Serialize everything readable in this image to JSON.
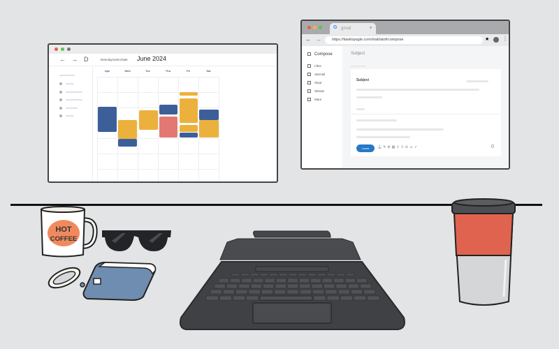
{
  "calendar": {
    "breadcrumb": "Deenlaymartcchate",
    "month": "June 2024",
    "days": [
      "Upe",
      "Wed",
      "Tue",
      "Thu",
      "Fri",
      "Sat"
    ]
  },
  "mail": {
    "tab_title": "gmail",
    "url": "https://fawilopogle.com/mail/atofrcompose",
    "compose": "Compose",
    "nav": [
      "Lftes",
      "Sarmail",
      "Stsat",
      "Sbeats",
      "Mare"
    ],
    "header": "Subject",
    "card_subject": "Subject",
    "send": "Lnear",
    "count": "0"
  },
  "desk": {
    "mug_text_1": "HOT",
    "mug_text_2": "COFFEE"
  },
  "colors": {
    "blue": "#3d5f99",
    "yellow": "#ecb13d",
    "red": "#e37774",
    "accent": "#2679c6",
    "mug_label": "#f08a5d",
    "tumbler_band": "#e0634f"
  }
}
